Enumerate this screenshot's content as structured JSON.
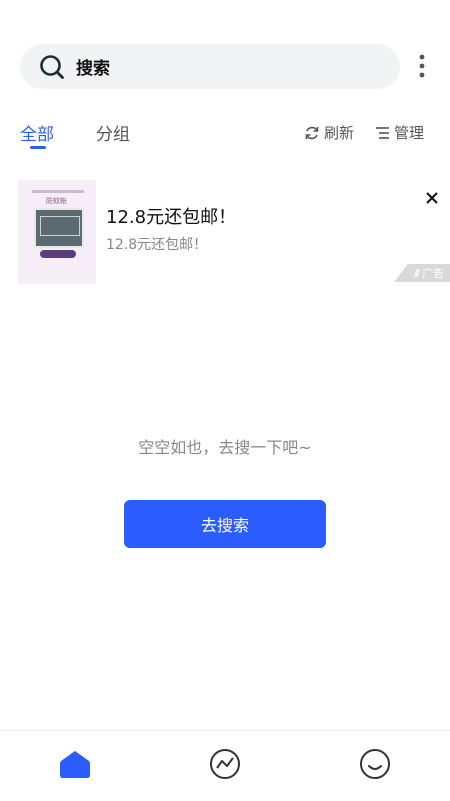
{
  "search": {
    "label": "搜索",
    "icon": "search-icon"
  },
  "header": {
    "more_icon": "more-vertical-icon"
  },
  "tabs": [
    {
      "label": "全部",
      "active": true
    },
    {
      "label": "分组",
      "active": false
    }
  ],
  "actions": {
    "refresh_label": "刷新",
    "refresh_icon": "refresh-icon",
    "manage_label": "管理",
    "manage_icon": "list-icon"
  },
  "ad": {
    "title": "12.8元还包邮！",
    "subtitle": "12.8元还包邮！",
    "badge": "广告",
    "thumbnail_caption": "防蚊帐"
  },
  "empty_state": {
    "message": "空空如也，去搜一下吧~",
    "button_label": "去搜索"
  },
  "bottom_nav": [
    {
      "icon": "home-icon",
      "active": true
    },
    {
      "icon": "trend-icon",
      "active": false
    },
    {
      "icon": "smile-icon",
      "active": false
    }
  ],
  "colors": {
    "accent": "#2b5cff",
    "muted": "#888888",
    "search_bg": "#f2f3f5"
  }
}
